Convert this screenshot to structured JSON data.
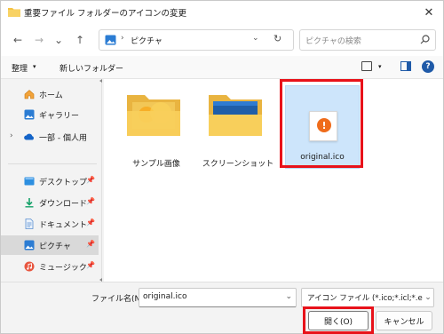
{
  "window": {
    "title": "重要ファイル フォルダーのアイコンの変更",
    "close_glyph": "✕"
  },
  "nav": {
    "back_glyph": "←",
    "forward_glyph": "→",
    "recent_glyph": "⌄",
    "up_glyph": "↑",
    "address_separator": "›",
    "address_location": "ピクチャ",
    "address_dropdown_glyph": "⌄",
    "refresh_glyph": "↻",
    "search_placeholder": "ピクチャの検索"
  },
  "toolbar": {
    "organize_label": "整理",
    "organize_arrow": "▾",
    "new_folder_label": "新しいフォルダー",
    "view_arrow": "▾",
    "help_glyph": "?"
  },
  "sidebar": {
    "items": [
      {
        "label": "ホーム",
        "icon": "home-icon",
        "chevron": "",
        "pinned": false,
        "selected": false
      },
      {
        "label": "ギャラリー",
        "icon": "gallery-icon",
        "chevron": "",
        "pinned": false,
        "selected": false
      },
      {
        "label": "一部 - 個人用",
        "icon": "onedrive-icon",
        "chevron": "›",
        "pinned": false,
        "selected": false
      },
      {
        "label": "デスクトップ",
        "icon": "desktop-icon",
        "chevron": "",
        "pinned": true,
        "selected": false
      },
      {
        "label": "ダウンロード",
        "icon": "download-icon",
        "chevron": "",
        "pinned": true,
        "selected": false
      },
      {
        "label": "ドキュメント",
        "icon": "document-icon",
        "chevron": "",
        "pinned": true,
        "selected": false
      },
      {
        "label": "ピクチャ",
        "icon": "pictures-icon",
        "chevron": "",
        "pinned": true,
        "selected": true
      },
      {
        "label": "ミュージック",
        "icon": "music-icon",
        "chevron": "",
        "pinned": true,
        "selected": false
      }
    ],
    "pin_glyph": "📌"
  },
  "files": [
    {
      "name": "サンプル画像",
      "type": "folder-with-image",
      "selected": false
    },
    {
      "name": "スクリーンショット",
      "type": "folder-with-screenshot",
      "selected": false
    },
    {
      "name": "original.ico",
      "type": "icon-file",
      "selected": true,
      "glyph": "!"
    }
  ],
  "footer": {
    "filename_label": "ファイル名(N):",
    "filename_value": "original.ico",
    "filename_dropdown_glyph": "⌄",
    "filetype_value": "アイコン ファイル (*.ico;*.icl;*.exe;*.dll)",
    "filetype_dropdown_glyph": "⌄",
    "open_label": "開く(O)",
    "cancel_label": "キャンセル"
  },
  "colors": {
    "highlight_frame": "#e8121a",
    "selection_bg": "#cde5fb",
    "accent": "#1f5aa8",
    "ico_badge": "#ef6c1b"
  }
}
